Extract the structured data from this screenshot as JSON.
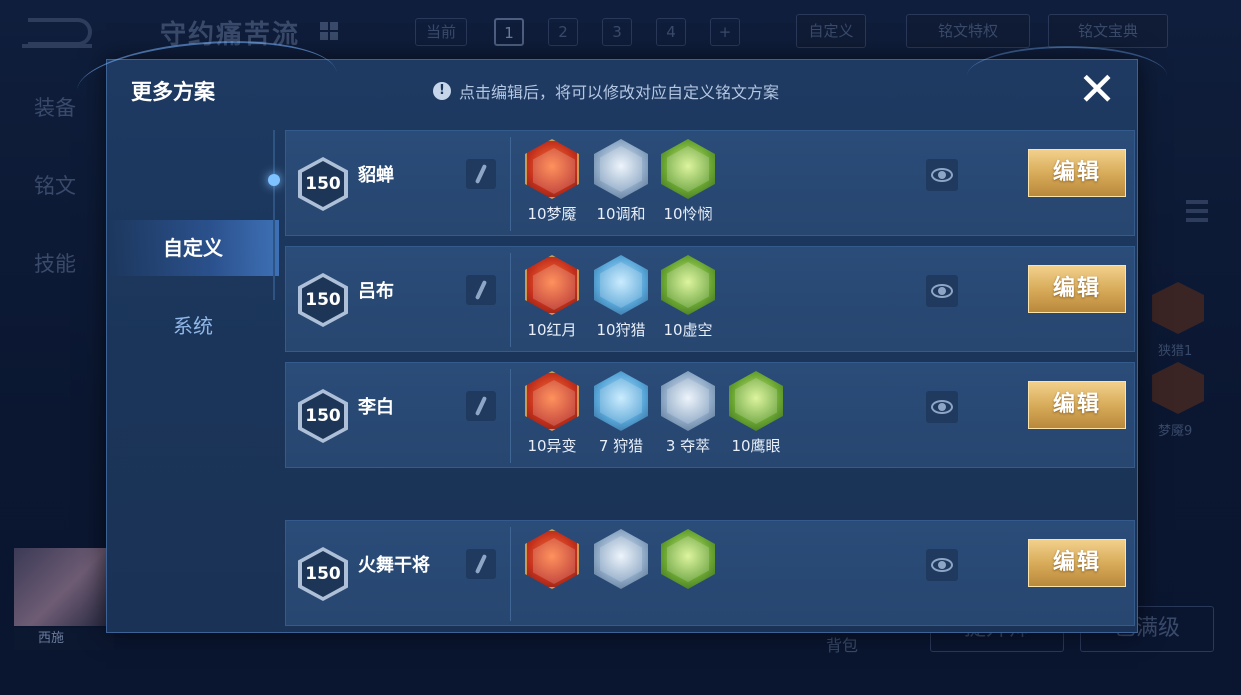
{
  "background": {
    "title": "守约痛苦流",
    "current_label": "当前",
    "pages": [
      "1",
      "2",
      "3",
      "4",
      "+"
    ],
    "custom_label": "自定义",
    "privilege_label": "铭文特权",
    "dictionary_label": "铭文宝典",
    "side_items": [
      "装备",
      "铭文",
      "技能"
    ],
    "right_labels": [
      "狭猎1",
      "梦魇9"
    ],
    "hero_name": "西施",
    "bag_label": "背包",
    "upgrade_label": "提升师",
    "maxed_label": "已满级"
  },
  "modal": {
    "title": "更多方案",
    "hint": "点击编辑后，将可以修改对应自定义铭文方案",
    "close_icon": "close-icon",
    "tabs": [
      "自定义",
      "系统"
    ],
    "edit_label": "编辑",
    "rows": [
      {
        "level": "150",
        "name": "貂蝉",
        "runes": [
          {
            "label": "10梦魇",
            "color": "red"
          },
          {
            "label": "10调和",
            "color": "silver"
          },
          {
            "label": "10怜悯",
            "color": "green"
          }
        ]
      },
      {
        "level": "150",
        "name": "吕布",
        "runes": [
          {
            "label": "10红月",
            "color": "red"
          },
          {
            "label": "10狩猎",
            "color": "blue"
          },
          {
            "label": "10虚空",
            "color": "green"
          }
        ]
      },
      {
        "level": "150",
        "name": "李白",
        "runes": [
          {
            "label": "10异变",
            "color": "red"
          },
          {
            "label": "7 狩猎",
            "color": "blue"
          },
          {
            "label": "3 夺萃",
            "color": "silver"
          },
          {
            "label": "10鹰眼",
            "color": "green"
          }
        ]
      },
      {
        "level": "150",
        "name": "火舞干将",
        "runes": [
          {
            "label": "",
            "color": "red"
          },
          {
            "label": "",
            "color": "silver"
          },
          {
            "label": "",
            "color": "green"
          }
        ]
      }
    ]
  },
  "colors": {
    "accent_gold": "#d8ac5a",
    "panel_blue": "#1e3a62",
    "row_blue": "#2a4c78"
  }
}
